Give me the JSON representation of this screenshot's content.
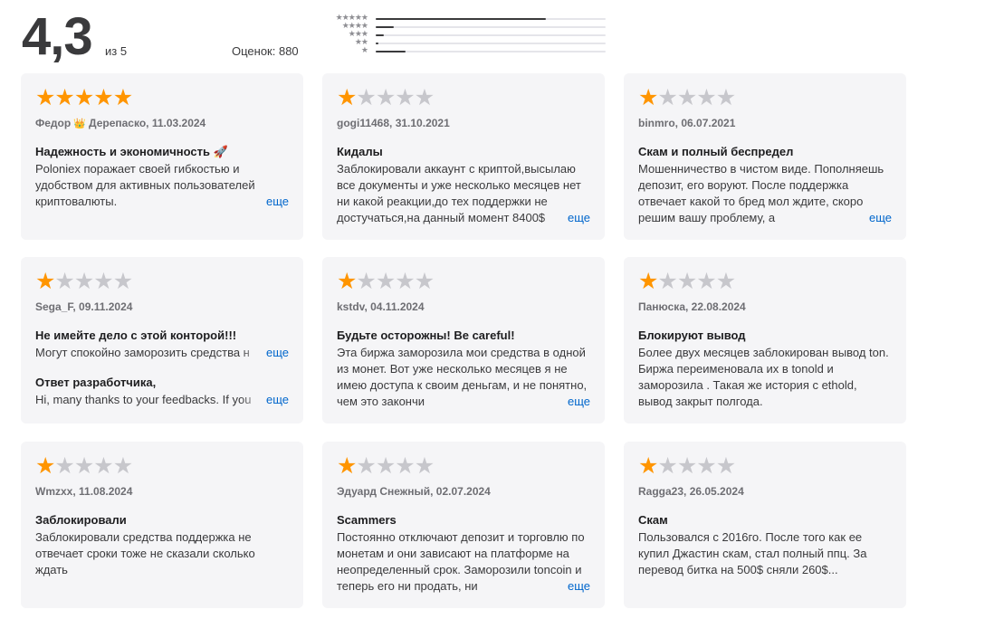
{
  "summary": {
    "rating": "4,3",
    "out_of": "из 5",
    "count_label": "Оценок: 880",
    "histogram": [
      {
        "stars": "★★★★★",
        "fraction": 0.74
      },
      {
        "stars": "★★★★",
        "fraction": 0.08
      },
      {
        "stars": "★★★",
        "fraction": 0.035
      },
      {
        "stars": "★★",
        "fraction": 0.01
      },
      {
        "stars": "★",
        "fraction": 0.13
      }
    ]
  },
  "more_label": "еще",
  "reviews": [
    {
      "rating": 5,
      "author": "Федор",
      "author_suffix": "Дерепаско, 11.03.2024",
      "title": "Надежность и экономичность 🚀",
      "body": "Poloniex поражает своей гибкостью и удобством для активных пользователей криптовалюты.",
      "has_more": true
    },
    {
      "rating": 1,
      "author": "gogi11468, 31.10.2021",
      "title": "Кидалы",
      "body": "Заблокировали аккаунт с криптой,высылаю все документы и уже несколько месяцев нет ни какой реакции,до тех поддержки не достучаться,на данный момент 8400$",
      "has_more": true
    },
    {
      "rating": 1,
      "author": "binmro, 06.07.2021",
      "title": "Скам и полный беспредел",
      "body": "Мошенничество в чистом виде. Пополняешь депозит, его воруют. После поддержка отвечает какой то бред мол ждите, скоро решим вашу проблему, а",
      "has_more": true
    },
    {
      "rating": 1,
      "author": "Sega_F, 09.11.2024",
      "title": "Не имейте дело с этой конторой!!!",
      "body": "Могут спокойно заморозить средства н",
      "has_more": true,
      "dev_title": "Ответ разработчика,",
      "dev_body": "Hi, many thanks to your feedbacks. If you"
    },
    {
      "rating": 1,
      "author": "kstdv, 04.11.2024",
      "title": "Будьте осторожны! Be careful!",
      "body": "Эта биржа заморозила мои средства в одной из монет. Вот уже несколько месяцев я не имею доступа к своим деньгам, и не понятно, чем это закончи",
      "has_more": true
    },
    {
      "rating": 1,
      "author": "Панюска, 22.08.2024",
      "title": "Блокируют вывод",
      "body": "Более двух месяцев заблокирован вывод ton. Биржа переименовала их в tonold и заморозила . Такая же история с ethold, вывод закрыт полгода.",
      "has_more": false
    },
    {
      "rating": 1,
      "author": "Wmzxx, 11.08.2024",
      "title": "Заблокировали",
      "body": "Заблокировали средства поддержка не отвечает сроки тоже не сказали сколько ждать",
      "has_more": false
    },
    {
      "rating": 1,
      "author": "Эдуард Снежный, 02.07.2024",
      "title": "Scammers",
      "body": "Постоянно отключают депозит и торговлю по монетам и они зависают на платформе на неопределенный срок. Заморозили toncoin и теперь его ни продать, ни",
      "has_more": true
    },
    {
      "rating": 1,
      "author": "Ragga23, 26.05.2024",
      "title": "Скам",
      "body": "Пользовался с 2016го. После того как ее купил Джастин скам, стал полный ппц. За перевод битка на 500$ сняли 260$...",
      "has_more": false
    }
  ]
}
